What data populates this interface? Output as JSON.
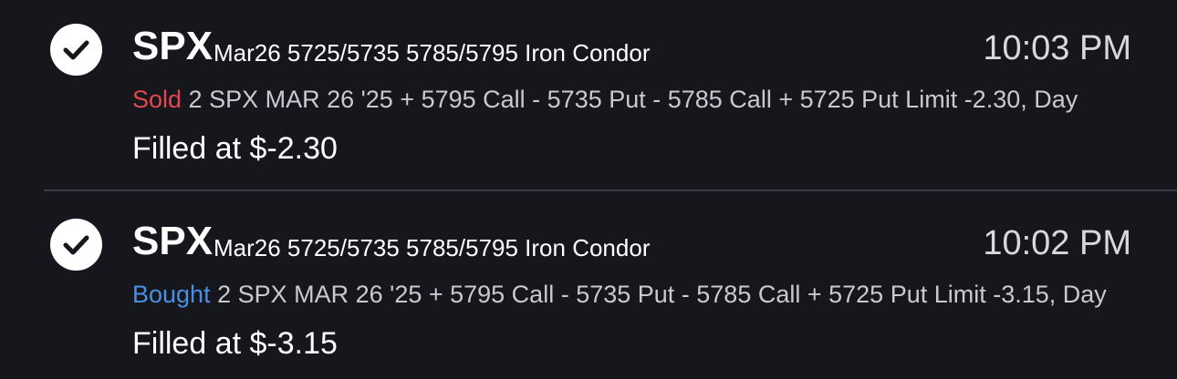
{
  "orders": [
    {
      "symbol": "SPX",
      "description": "Mar26 5725/5735 5785/5795 Iron Condor",
      "time": "10:03 PM",
      "side": "Sold",
      "side_color": "#e5474f",
      "detail": " 2 SPX MAR 26 '25 + 5795 Call - 5735 Put - 5785 Call + 5725 Put Limit -2.30, Day",
      "filled": "Filled at $-2.30",
      "status_icon": "check-icon"
    },
    {
      "symbol": "SPX",
      "description": "Mar26 5725/5735 5785/5795 Iron Condor",
      "time": "10:02 PM",
      "side": "Bought",
      "side_color": "#4a90e2",
      "detail": " 2 SPX MAR 26 '25 + 5795 Call - 5735 Put - 5785 Call + 5725 Put Limit -3.15, Day",
      "filled": "Filled at $-3.15",
      "status_icon": "check-icon"
    }
  ],
  "colors": {
    "background": "#16171d",
    "divider": "#3a3c44",
    "text": "#ffffff"
  }
}
